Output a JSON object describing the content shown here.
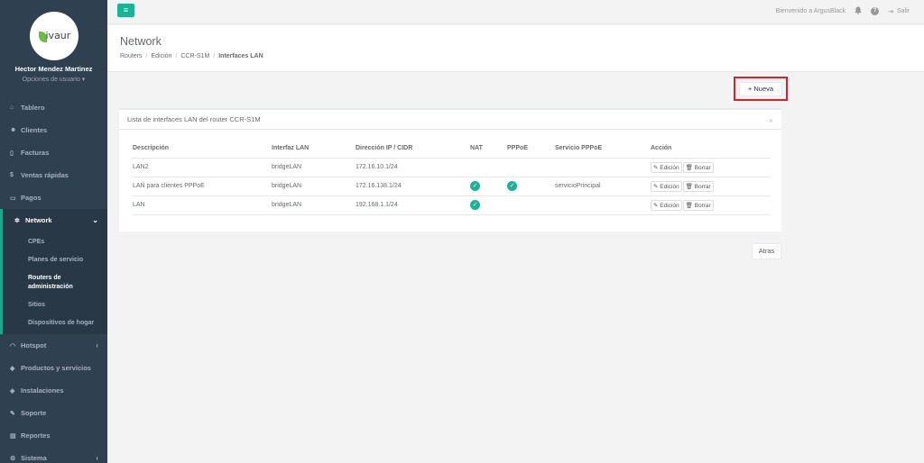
{
  "brand": {
    "logo_text": "ivaur"
  },
  "user": {
    "name": "Hector Mendez Martinez",
    "options": "Opciones de usuario ▾"
  },
  "sidebar": {
    "items_top": [
      {
        "label": "Tablero",
        "icon": "dashboard-icon",
        "glyph": "⌂"
      },
      {
        "label": "Clientes",
        "icon": "users-icon",
        "glyph": "☻"
      },
      {
        "label": "Facturas",
        "icon": "file-icon",
        "glyph": "▯"
      },
      {
        "label": "Ventas rápidas",
        "icon": "dollar-icon",
        "glyph": "$"
      },
      {
        "label": "Pagos",
        "icon": "money-icon",
        "glyph": "▭"
      }
    ],
    "network": {
      "label": "Network",
      "glyph": "✲",
      "caret": "⌄"
    },
    "network_sub": [
      "CPEs",
      "Planes de servicio",
      "Routers de administración",
      "Sitios",
      "Dispositivos de hogar"
    ],
    "items_bottom": [
      {
        "label": "Hotspot",
        "icon": "wifi-icon",
        "glyph": "◠",
        "caret": "‹"
      },
      {
        "label": "Productos y servicios",
        "icon": "tag-icon",
        "glyph": "◆"
      },
      {
        "label": "Instalaciones",
        "icon": "wrench-icon",
        "glyph": "◈"
      },
      {
        "label": "Soporte",
        "icon": "tools-icon",
        "glyph": "✎"
      },
      {
        "label": "Reportes",
        "icon": "book-icon",
        "glyph": "▤"
      },
      {
        "label": "Sistema",
        "icon": "cogs-icon",
        "glyph": "⚙",
        "caret": "‹"
      }
    ]
  },
  "topbar": {
    "menu_glyph": "≡",
    "welcome": "Bienvenido a ArgusBlack",
    "bell_glyph": "🔔",
    "help_glyph": "?",
    "logout_glyph": "⇥",
    "logout": "Salir"
  },
  "header": {
    "title": "Network",
    "breadcrumb": [
      "Routers",
      "Edición",
      "CCR-S1M",
      "Interfaces LAN"
    ]
  },
  "actions": {
    "nueva": "+ Nueva",
    "atras": "Atras"
  },
  "panel": {
    "title": "Lista de interfaces LAN del router CCR-S1M",
    "close": "×",
    "columns": [
      "Descripción",
      "Interfaz LAN",
      "Dirección IP / CIDR",
      "NAT",
      "PPPoE",
      "Servicio PPPoE",
      "Acción"
    ],
    "rows": [
      {
        "descripcion": "LAN2",
        "interfaz": "bridgeLAN",
        "ip": "172.16.10.1/24",
        "nat": false,
        "pppoe": false,
        "servicio": ""
      },
      {
        "descripcion": "LAN para clientes PPPoE",
        "interfaz": "bridgeLAN",
        "ip": "172.16.138.1/24",
        "nat": true,
        "pppoe": true,
        "servicio": "servicioPrincipal"
      },
      {
        "descripcion": "LAN",
        "interfaz": "bridgeLAN",
        "ip": "192.168.1.1/24",
        "nat": true,
        "pppoe": false,
        "servicio": ""
      }
    ],
    "edit_label": "✎ Edición",
    "delete_label": "🗑 Borrar"
  },
  "colors": {
    "sidebar": "#2f4050",
    "accent": "#1ab394",
    "highlight": "#e01e25"
  }
}
